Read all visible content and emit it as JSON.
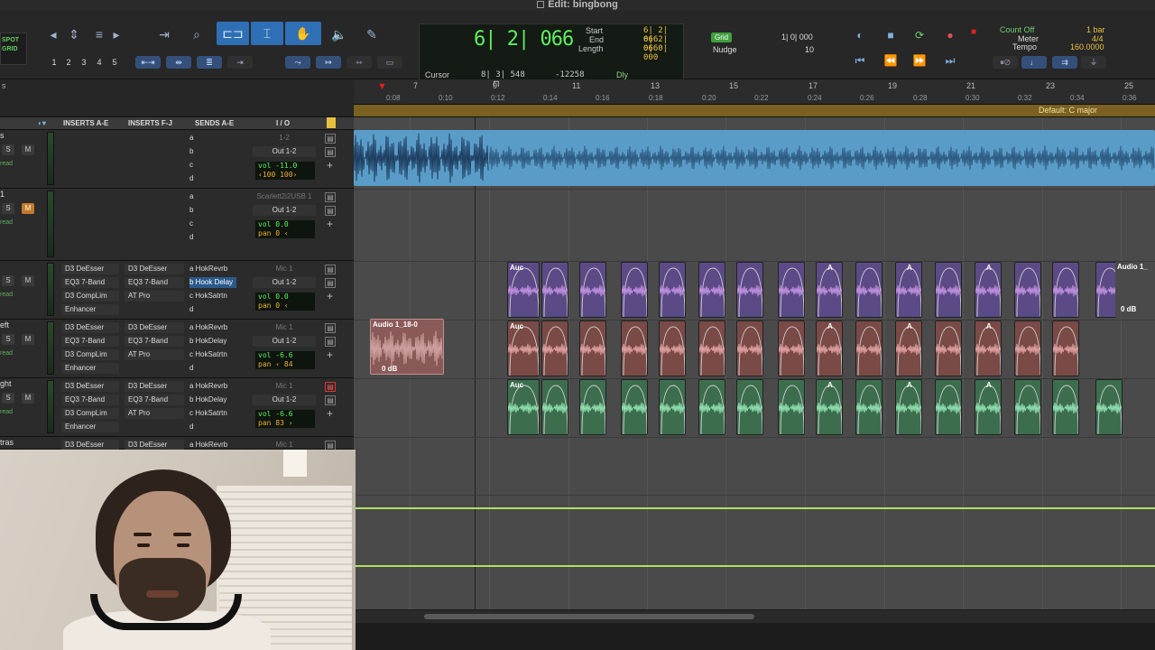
{
  "title": "Edit: bingbong",
  "toolbar": {
    "mode_lines": [
      "SPOT",
      "GRID"
    ],
    "zoom_presets": [
      "1",
      "2",
      "3",
      "4",
      "5"
    ],
    "counter": {
      "main": "6| 2| 066",
      "start_label": "Start",
      "end_label": "End",
      "length_label": "Length",
      "start_val": "6| 2| 066",
      "end_val": "6| 2| 066",
      "length_val": "0| 0| 000",
      "cursor_label": "Cursor",
      "cursor_val": "8| 3| 548",
      "cursor_sample": "-12258",
      "dly_label": "Dly"
    },
    "grid": {
      "tag": "Grid",
      "grid_val": "1| 0| 000",
      "nudge_label": "Nudge",
      "nudge_val": "10"
    },
    "tempo": {
      "count_off": "Count Off",
      "meter_label": "Meter",
      "tempo_label": "Tempo",
      "bar": "1 bar",
      "meter_val": "4/4",
      "tempo_val": "160.0000"
    }
  },
  "ruler": {
    "bars": [
      "7",
      "9",
      "11",
      "13",
      "15",
      "17",
      "19",
      "21",
      "23",
      "25"
    ],
    "times": [
      "0:08",
      "0:10",
      "0:12",
      "0:14",
      "0:16",
      "0:18",
      "0:20",
      "0:22",
      "0:24",
      "0:26",
      "0:28",
      "0:30",
      "0:32",
      "0:34",
      "0:36"
    ],
    "key": "Default: C major"
  },
  "mix_header": {
    "inserts_ae": "INSERTS A-E",
    "inserts_fj": "INSERTS F-J",
    "sends_ae": "SENDS A-E",
    "io": "I / O"
  },
  "tracks": [
    {
      "name": "s",
      "inserts_ae": [
        "",
        "",
        "",
        ""
      ],
      "inserts_fj": [
        "",
        "",
        "",
        ""
      ],
      "sends": [
        "a",
        "b",
        "c",
        "d"
      ],
      "input": "1-2",
      "output": "Out 1-2",
      "vol": "vol   -11.0",
      "pan": "‹100   100›",
      "m_on": false,
      "red_icon": false
    },
    {
      "name": "1",
      "inserts_ae": [
        "",
        "",
        "",
        ""
      ],
      "inserts_fj": [
        "",
        "",
        "",
        ""
      ],
      "sends": [
        "a",
        "b",
        "c",
        "d"
      ],
      "input": "Scarlett2i2USB 1",
      "output": "Out 1-2",
      "vol": "vol     0.0",
      "pan": "pan     0 ‹",
      "m_on": true,
      "red_icon": false
    },
    {
      "name": "",
      "inserts_ae": [
        "D3 DeEsser",
        "EQ3 7-Band",
        "D3 CompLim",
        "Enhancer"
      ],
      "inserts_fj": [
        "D3 DeEsser",
        "EQ3 7-Band",
        "AT Pro",
        ""
      ],
      "sends": [
        "a HokRevrb",
        "b Hook Delay",
        "c HokSatrtn",
        "d"
      ],
      "input": "Mic 1",
      "output": "Out 1-2",
      "vol": "vol     0.0",
      "pan": "pan     0 ‹",
      "m_on": false,
      "red_icon": false
    },
    {
      "name": "eft",
      "inserts_ae": [
        "D3 DeEsser",
        "EQ3 7-Band",
        "D3 CompLim",
        "Enhancer"
      ],
      "inserts_fj": [
        "D3 DeEsser",
        "EQ3 7-Band",
        "AT Pro",
        ""
      ],
      "sends": [
        "a HokRevrb",
        "b HokDelay",
        "c HokSatrtn",
        "d"
      ],
      "input": "Mic 1",
      "output": "Out 1-2",
      "vol": "vol    -6.6",
      "pan": "pan   ‹ 84",
      "m_on": false,
      "red_icon": false
    },
    {
      "name": "ght",
      "inserts_ae": [
        "D3 DeEsser",
        "EQ3 7-Band",
        "D3 CompLim",
        "Enhancer"
      ],
      "inserts_fj": [
        "D3 DeEsser",
        "EQ3 7-Band",
        "AT Pro",
        ""
      ],
      "sends": [
        "a HokRevrb",
        "b HokDelay",
        "c HokSatrtn",
        "d"
      ],
      "input": "Mic 1",
      "output": "Out 1-2",
      "vol": "vol    -6.6",
      "pan": "pan     83 ›",
      "m_on": false,
      "red_icon": true
    },
    {
      "name": "tras",
      "inserts_ae": [
        "D3 DeEsser"
      ],
      "inserts_fj": [
        "D3 DeEsser"
      ],
      "sends": [
        "a HokRevrb"
      ],
      "input": "Mic 1",
      "output": "",
      "vol": "",
      "pan": "",
      "m_on": false,
      "red_icon": false
    }
  ],
  "track_shared": {
    "s_label": "S",
    "m_label": "M",
    "read_label": "read"
  },
  "clips": {
    "loose_clip_name": "Audio 1_18-0",
    "loose_clip_gain": "0 dB",
    "auc_label": "Auc",
    "a_label": "A",
    "edge_clip_name": "Audio 1_",
    "edge_clip_gain": "0 dB"
  },
  "colors": {
    "accent_blue": "#2f6fb5",
    "clip_blue": "#5a9cc8",
    "clip_purple": "#5b4a86",
    "clip_red": "#7a4a46",
    "clip_green": "#3c6e4e",
    "counter_green": "#5ef05e",
    "key_strip": "#7a6121",
    "automation": "#b0e060"
  }
}
